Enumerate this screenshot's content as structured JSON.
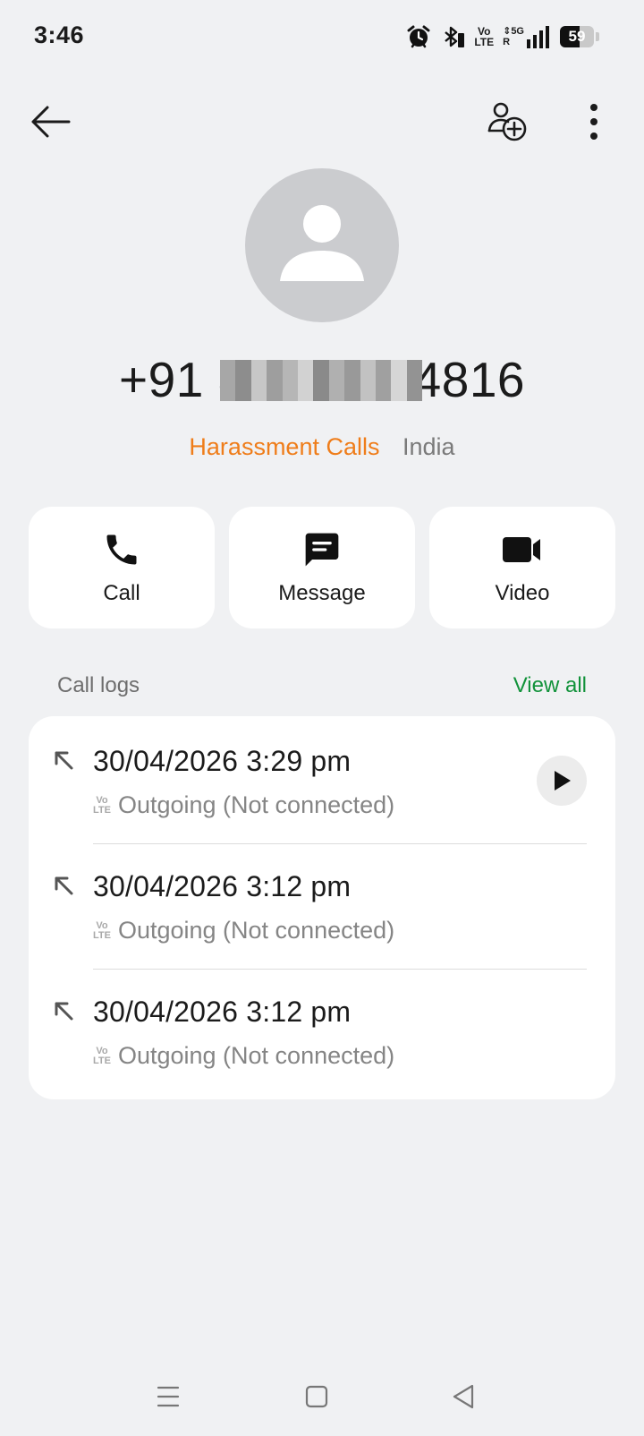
{
  "status_bar": {
    "time": "3:46",
    "battery_level": 59,
    "battery_text": "59",
    "network": "5G",
    "volte_top": "Vo",
    "volte_bottom": "LTE",
    "icons": [
      "alarm-icon",
      "bluetooth-icon",
      "volte-icon",
      "data-arrows-icon",
      "signal-icon",
      "battery-icon"
    ]
  },
  "toolbar": {
    "back_icon": "arrow-left-icon",
    "add_contact_icon": "person-add-icon",
    "more_icon": "more-vertical-icon"
  },
  "contact": {
    "number_prefix": "+91 8",
    "number_suffix": "4816",
    "tag": "Harassment Calls",
    "country": "India",
    "tag_color": "#ef7d1a"
  },
  "actions": [
    {
      "label": "Call",
      "icon": "phone-icon"
    },
    {
      "label": "Message",
      "icon": "message-icon"
    },
    {
      "label": "Video",
      "icon": "video-camera-icon"
    }
  ],
  "call_logs": {
    "title": "Call logs",
    "view_all": "View all",
    "view_all_color": "#11923a",
    "items": [
      {
        "datetime": "30/04/2026 3:29 pm",
        "status": "Outgoing (Not connected)",
        "has_recording": true
      },
      {
        "datetime": "30/04/2026 3:12 pm",
        "status": "Outgoing (Not connected)",
        "has_recording": false
      },
      {
        "datetime": "30/04/2026 3:12 pm",
        "status": "Outgoing (Not connected)",
        "has_recording": false
      }
    ]
  },
  "nav_bar": {
    "icons": [
      "menu-icon",
      "home-square-icon",
      "back-triangle-icon"
    ]
  }
}
